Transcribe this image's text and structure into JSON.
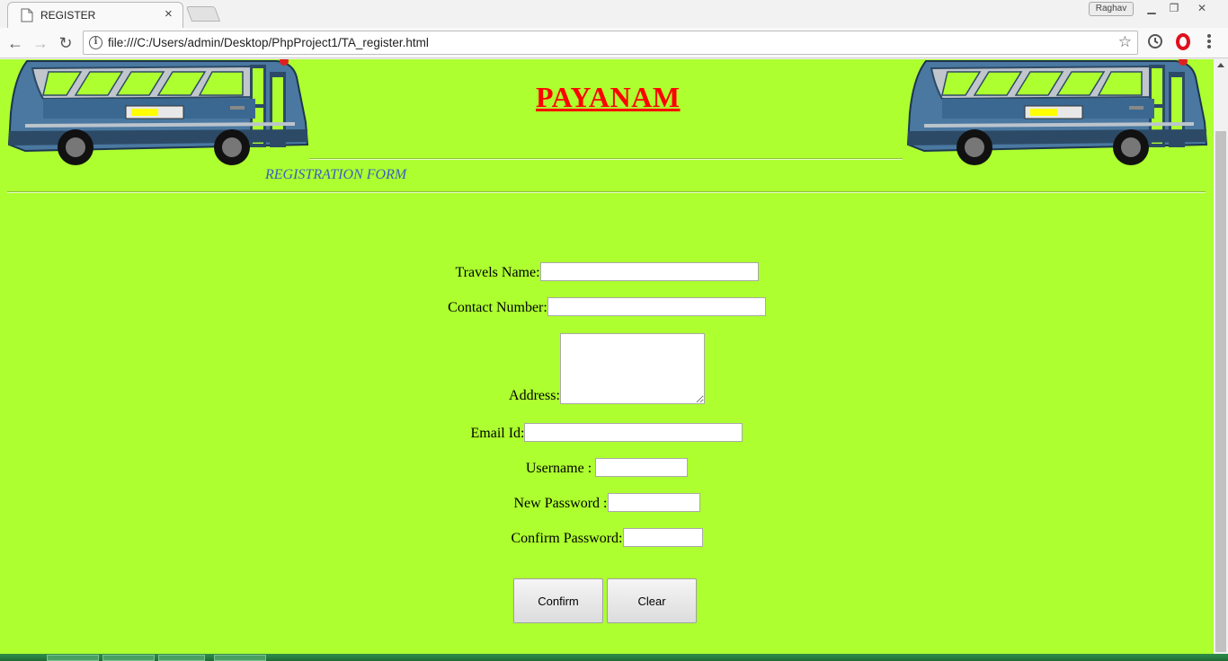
{
  "browser": {
    "tab_title": "REGISTER",
    "tab_close": "×",
    "profile_name": "Raghav",
    "url": "file:///C:/Users/admin/Desktop/PhpProject1/TA_register.html",
    "icons": [
      "page-icon",
      "back-icon",
      "forward-icon",
      "reload-icon",
      "info-icon",
      "star-icon",
      "history-icon",
      "opera-icon",
      "menu-icon"
    ]
  },
  "page": {
    "background_color": "#adff2f",
    "title": "PAYANAM",
    "title_color": "#ff0000",
    "form_heading": "REGISTRATION FORM",
    "form_heading_color": "#3b5fc0",
    "fields": {
      "travels_name": {
        "label": "Travels Name:",
        "value": ""
      },
      "contact_number": {
        "label": "Contact Number:",
        "value": ""
      },
      "address": {
        "label": "Address:",
        "value": ""
      },
      "email_id": {
        "label": "Email Id:",
        "value": ""
      },
      "username": {
        "label": "Username :",
        "value": ""
      },
      "new_password": {
        "label": "New Password :",
        "value": ""
      },
      "confirm_password": {
        "label": "Confirm Password:",
        "value": ""
      }
    },
    "buttons": {
      "confirm": "Confirm",
      "clear": "Clear"
    }
  }
}
